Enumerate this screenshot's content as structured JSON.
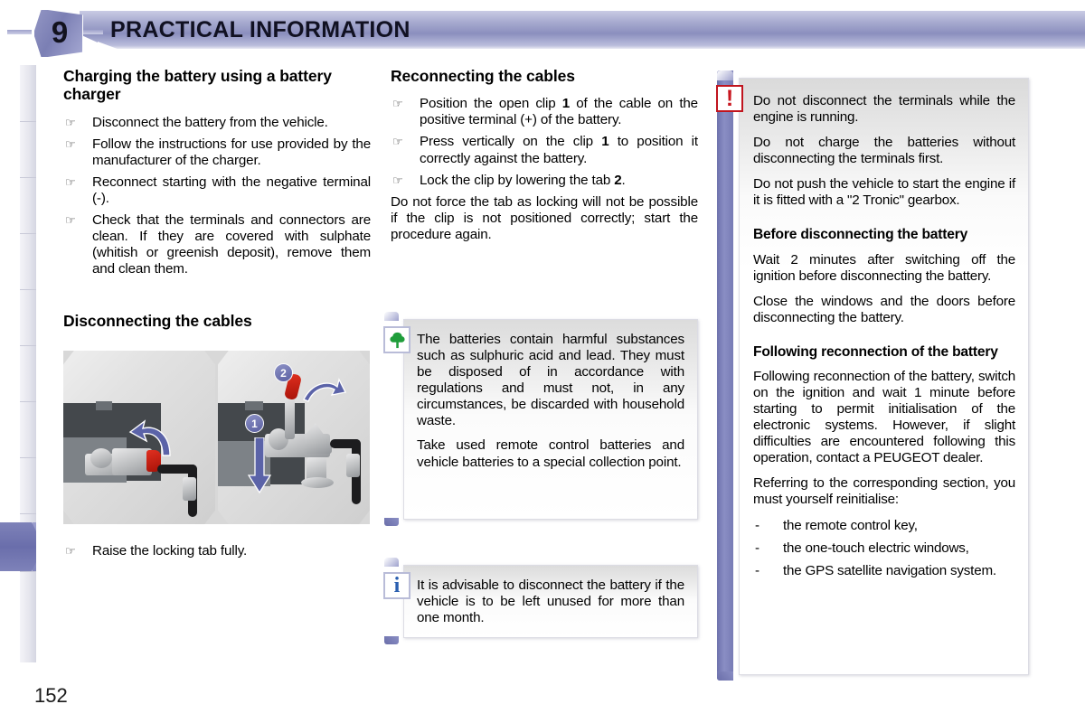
{
  "header": {
    "chapter_number": "9",
    "title": "PRACTICAL INFORMATION"
  },
  "page_number": "152",
  "tab_strip": {
    "total_tabs": 10,
    "active_index": 9,
    "active_color": "#7277b3"
  },
  "left_column": {
    "heading_1": "Charging the battery using a battery charger",
    "bullets_1": [
      "Disconnect the battery from the vehicle.",
      "Follow the instructions for use provided by the manufacturer of the charger.",
      "Reconnect starting with the negative terminal (-).",
      "Check that the terminals and connectors are clean. If they are covered with sulphate (whitish or greenish deposit), remove them and clean them."
    ],
    "heading_2": "Disconnecting the cables",
    "bullet_after_photo": "Raise the locking tab fully.",
    "illustration": {
      "callout_1": "1",
      "callout_2": "2"
    }
  },
  "middle_column": {
    "heading_1": "Reconnecting the cables",
    "bullet_1_a": "Position the open clip ",
    "bullet_1_ref": "1",
    "bullet_1_b": " of the cable on the positive terminal (+) of the battery.",
    "bullet_2_a": "Press vertically on the clip ",
    "bullet_2_ref": "1",
    "bullet_2_b": " to position it correctly against the battery.",
    "bullet_3_a": "Lock the clip by lowering the tab ",
    "bullet_3_ref": "2",
    "bullet_3_b": ".",
    "paragraph": "Do not force the tab as locking will not be possible if the clip is not positioned correctly; start the procedure again.",
    "environment_box": {
      "icon": "tree-icon",
      "icon_color": "#1f9d3a",
      "paragraph_1": "The batteries contain harmful substances such as sulphuric acid and lead. They must be disposed of in accordance with regulations and must not, in any circumstances, be discarded with household waste.",
      "paragraph_2": "Take used remote control batteries and vehicle batteries to a special collection point."
    },
    "info_box": {
      "icon": "info-icon",
      "icon_glyph": "i",
      "icon_color": "#2a5fb0",
      "paragraph_1": "It is advisable to disconnect the battery if the vehicle is to be left unused for more than one month."
    }
  },
  "right_column": {
    "warning_icon": "warning-exclamation-icon",
    "warning_glyph": "!",
    "warning_color": "#c8161f",
    "warning_paragraphs": [
      "Do not disconnect the terminals while the engine is running.",
      "Do not charge the batteries without disconnecting the terminals first.",
      "Do not push the vehicle to start the engine if it is fitted with a \"2 Tronic\" gearbox."
    ],
    "heading_1": "Before disconnecting the battery",
    "paragraphs_1": [
      "Wait 2 minutes after switching off the ignition before disconnecting the battery.",
      "Close the windows and the doors before disconnecting the battery."
    ],
    "heading_2": "Following reconnection of the battery",
    "paragraphs_2": [
      "Following reconnection of the battery, switch on the ignition and wait 1 minute before starting to permit initialisation of the electronic systems. However, if slight difficulties are encountered following this operation, contact a PEUGEOT dealer.",
      "Referring to the corresponding section, you must yourself reinitialise:"
    ],
    "dash_items": [
      "the remote control key,",
      "the one-touch electric windows,",
      "the GPS satellite navigation system."
    ]
  }
}
